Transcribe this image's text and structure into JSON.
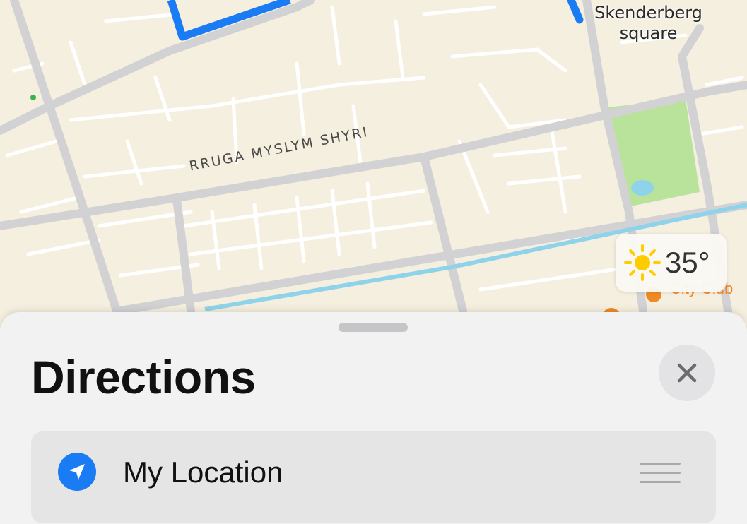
{
  "map": {
    "street_label": "RRUGA MYSLYM SHYRI",
    "place_label_line1": "Skenderberg",
    "place_label_line2": "square",
    "poi_label": "City Club"
  },
  "weather": {
    "temperature": "35°",
    "icon": "sun-icon"
  },
  "directions_sheet": {
    "title": "Directions",
    "close_icon": "close-icon",
    "from": {
      "label": "My Location",
      "icon": "location-arrow-icon",
      "handle_icon": "drag-handle-icon"
    }
  },
  "colors": {
    "map_background": "#f5efdf",
    "route": "#1a7cf5",
    "park": "#b9e39a",
    "water": "#8fd3ea",
    "sheet_background": "#f2f2f2",
    "accent_orange": "#f08a24"
  }
}
